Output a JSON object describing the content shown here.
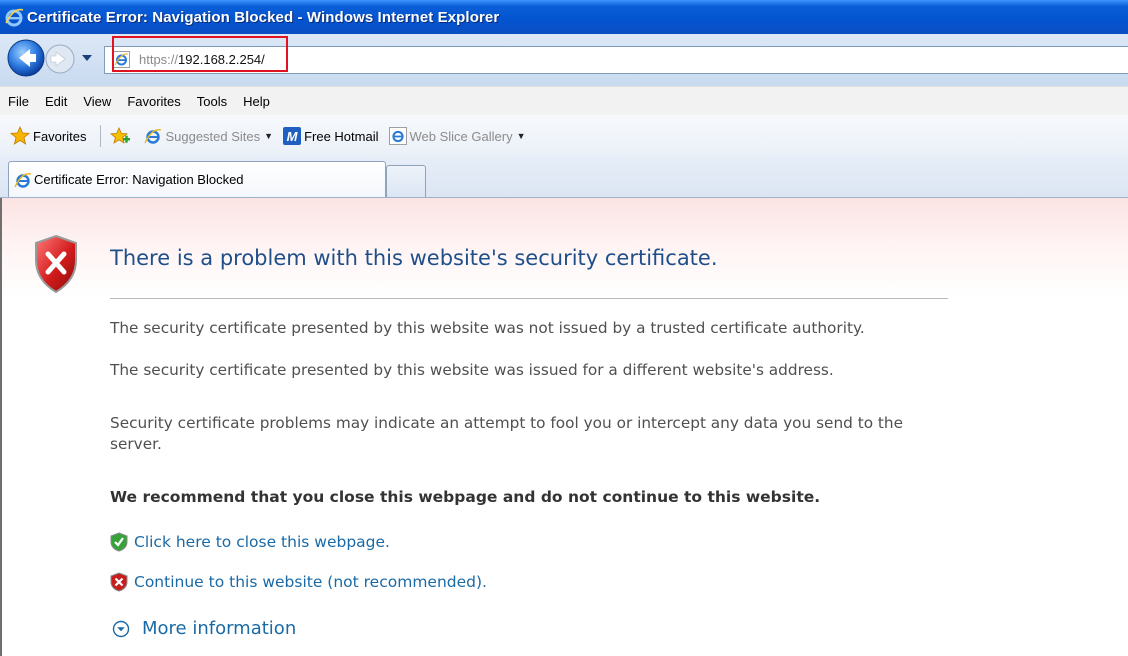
{
  "window": {
    "title": "Certificate Error: Navigation Blocked - Windows Internet Explorer"
  },
  "address_bar": {
    "url_scheme": "https://",
    "url_host": "192.168.2.254/"
  },
  "menu": {
    "items": [
      "File",
      "Edit",
      "View",
      "Favorites",
      "Tools",
      "Help"
    ]
  },
  "favorites_bar": {
    "favorites_label": "Favorites",
    "suggested_sites": "Suggested Sites",
    "free_hotmail": "Free Hotmail",
    "web_slice_gallery": "Web Slice Gallery"
  },
  "tabs": {
    "active_label": "Certificate Error: Navigation Blocked"
  },
  "page": {
    "heading": "There is a problem with this website's security certificate.",
    "paragraph_1": "The security certificate presented by this website was not issued by a trusted certificate authority.",
    "paragraph_2": "The security certificate presented by this website was issued for a different website's address.",
    "paragraph_3": "Security certificate problems may indicate an attempt to fool you or intercept any data you send to the server.",
    "recommendation": "We recommend that you close this webpage and do not continue to this website.",
    "close_link": "Click here to close this webpage.",
    "continue_link": "Continue to this website (not recommended).",
    "more_info": "More information"
  },
  "colors": {
    "title_bar": "#0454d0",
    "heading": "#1f4f8b",
    "link": "#1a6aa6",
    "highlight_box": "#e0141e"
  }
}
